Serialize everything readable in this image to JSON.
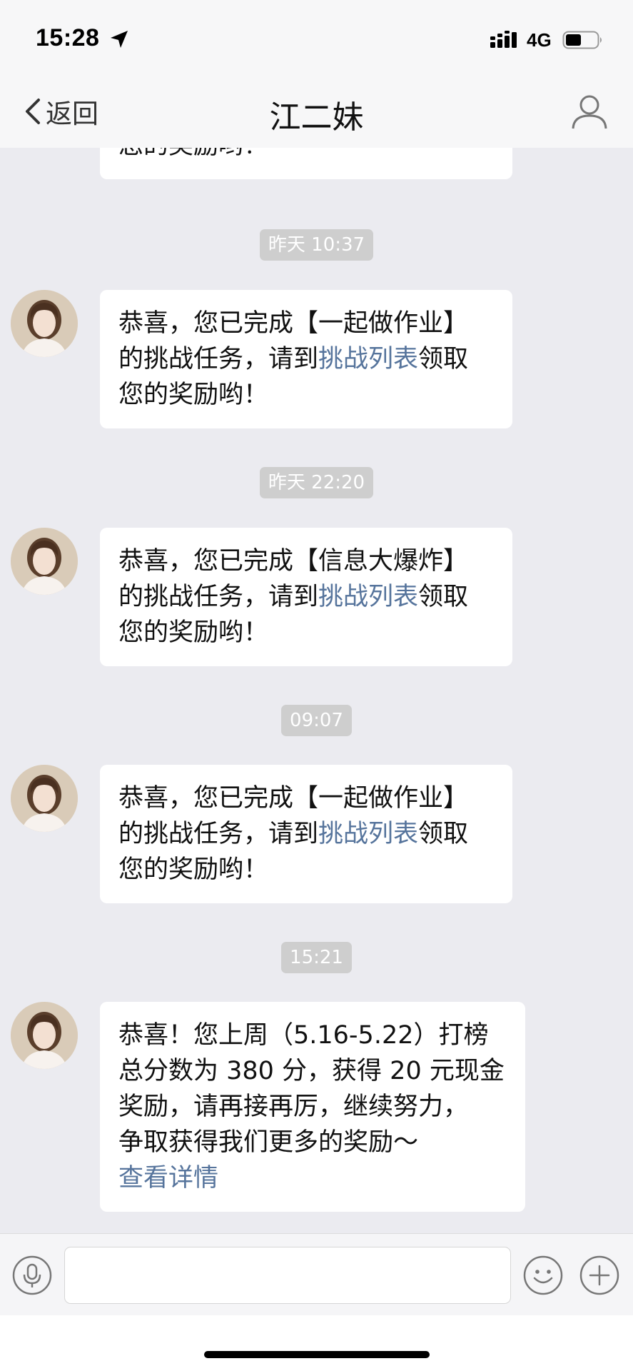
{
  "status_bar": {
    "time": "15:28",
    "network": "4G",
    "icons": [
      "location-arrow-icon",
      "signal-icon",
      "battery-icon"
    ]
  },
  "nav": {
    "back_label": "返回",
    "title": "江二妹",
    "back_icon": "chevron-left-icon",
    "profile_icon": "person-icon"
  },
  "colors": {
    "link": "#56749c",
    "background": "#ebebf0",
    "timestamp_bg": "#cecece"
  },
  "messages": {
    "m0": {
      "tail": "您的奖励哟！"
    },
    "t1": "昨天 10:37",
    "m1": {
      "l1": "恭喜，您已完成【一起做作业】",
      "l2_pre": "的挑战任务，请到",
      "l2_link": "挑战列表",
      "l2_post": "领取",
      "l3": "您的奖励哟！"
    },
    "t2": "昨天 22:20",
    "m2": {
      "l1": "恭喜，您已完成【信息大爆炸】",
      "l2_pre": "的挑战任务，请到",
      "l2_link": "挑战列表",
      "l2_post": "领取",
      "l3": "您的奖励哟！"
    },
    "t3": "09:07",
    "m3": {
      "l1": "恭喜，您已完成【一起做作业】",
      "l2_pre": "的挑战任务，请到",
      "l2_link": "挑战列表",
      "l2_post": "领取",
      "l3": "您的奖励哟！"
    },
    "t4": "15:21",
    "m4": {
      "l1": "恭喜！您上周（5.16-5.22）打榜",
      "l2": "总分数为 380 分，获得 20 元现金",
      "l3": "奖励，请再接再厉，继续努力，",
      "l4": "争取获得我们更多的奖励～",
      "link": "查看详情"
    }
  },
  "input_bar": {
    "placeholder": "",
    "icons": [
      "microphone-icon",
      "emoji-icon",
      "plus-icon"
    ]
  }
}
